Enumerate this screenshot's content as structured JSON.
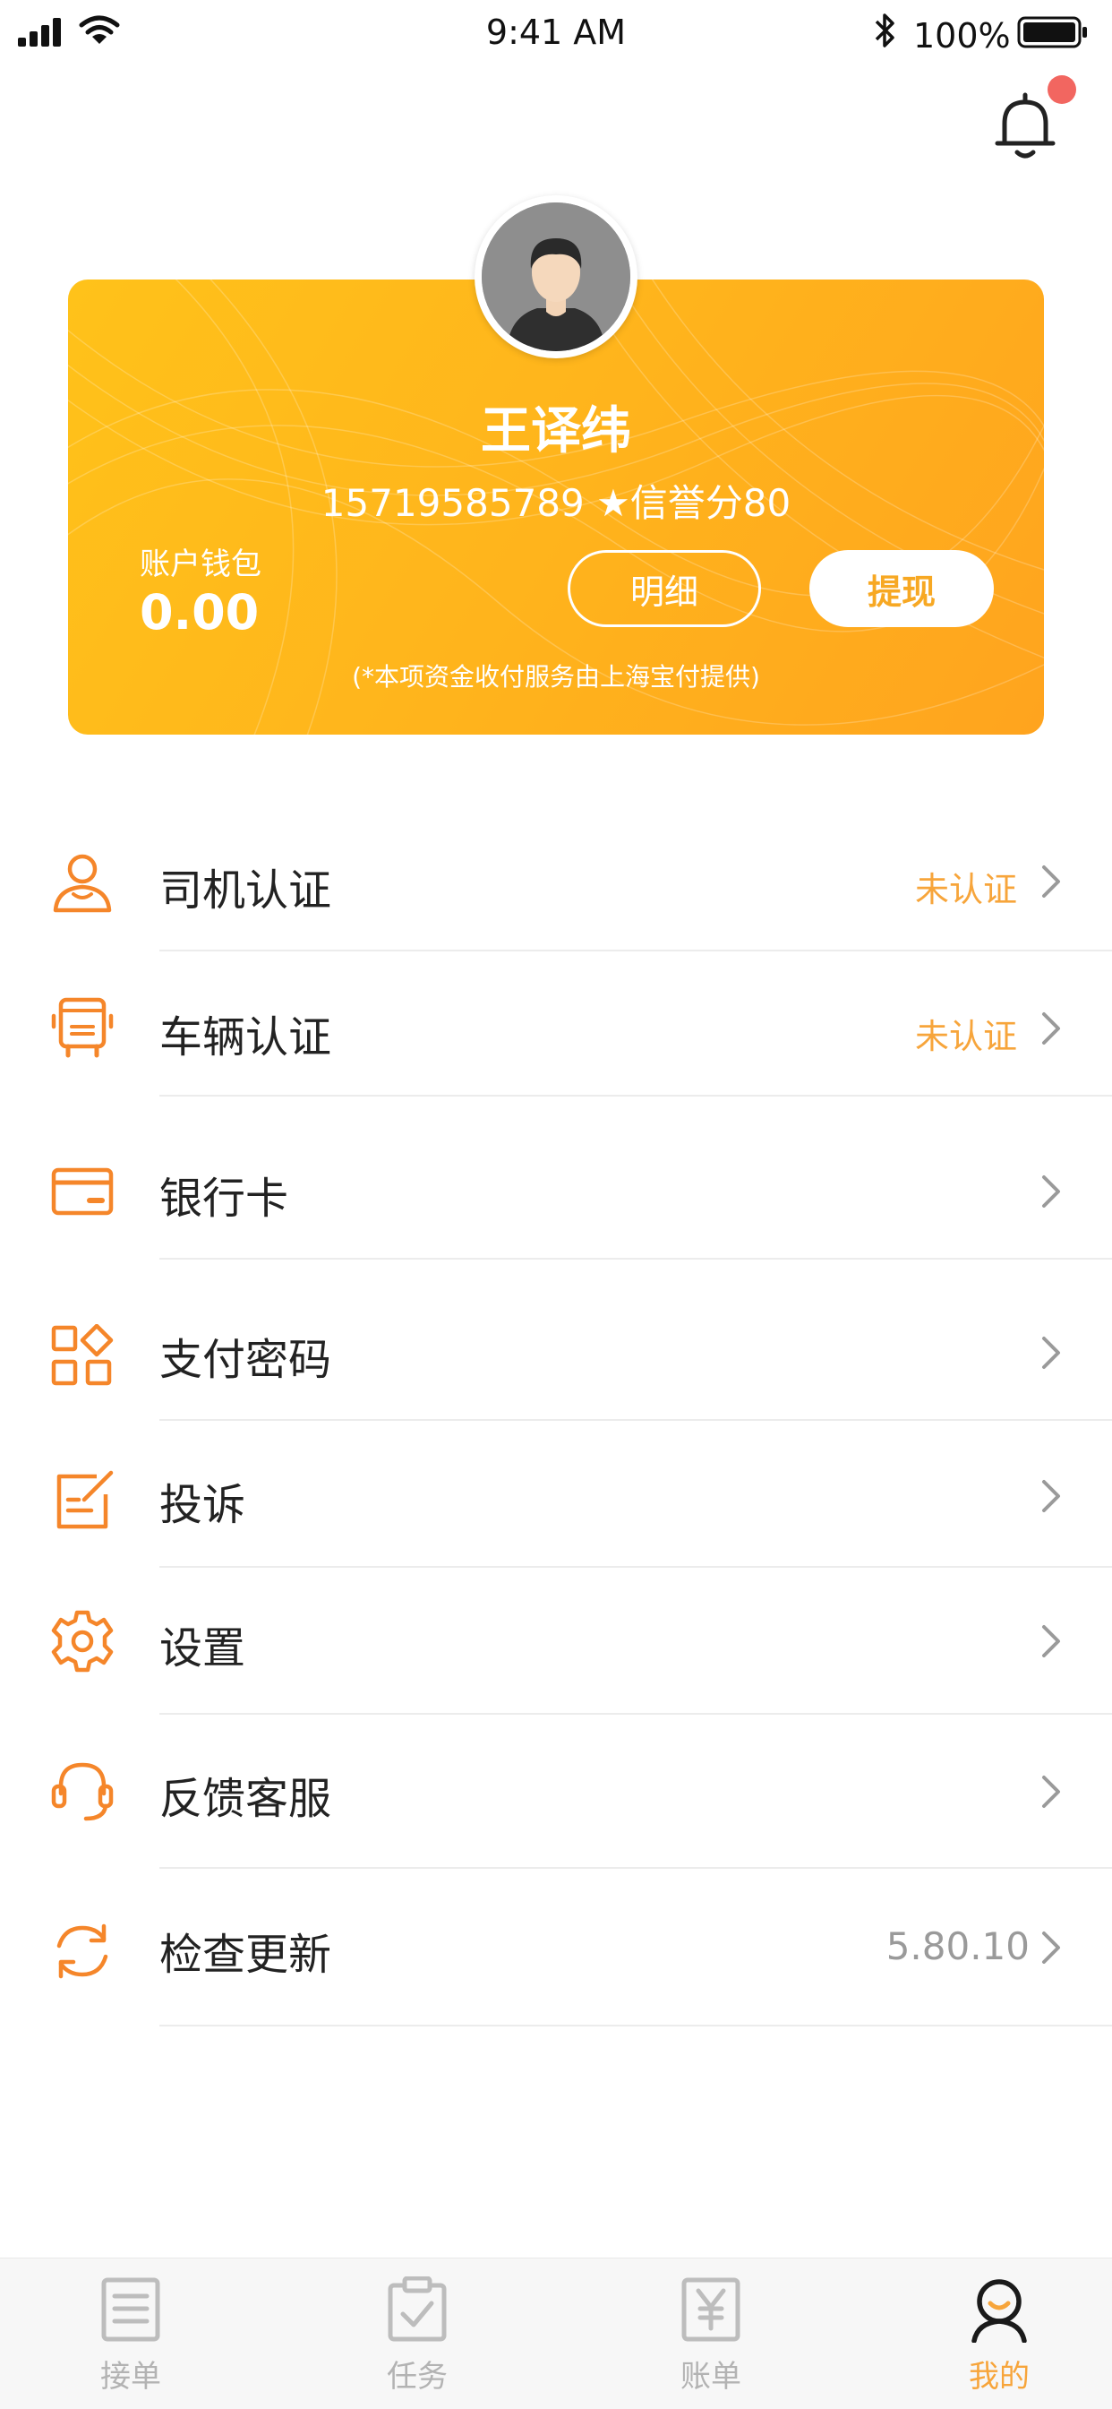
{
  "status_bar": {
    "time": "9:41 AM",
    "battery_percent": "100%"
  },
  "icons": {
    "bell": "bell-icon",
    "signal": "cellular-signal-icon",
    "wifi": "wifi-icon",
    "bluetooth": "bluetooth-icon",
    "battery": "battery-icon"
  },
  "profile": {
    "name": "王译纬",
    "info": "15719585789 ★信誉分80",
    "wallet_label": "账户钱包",
    "wallet_amount": "0.00",
    "detail_button": "明细",
    "withdraw_button": "提现",
    "note": "(*本项资金收付服务由上海宝付提供)"
  },
  "menu": [
    {
      "label": "司机认证",
      "status": "未认证",
      "icon": "driver-icon"
    },
    {
      "label": "车辆认证",
      "status": "未认证",
      "icon": "truck-icon"
    },
    {
      "label": "银行卡",
      "status": "",
      "icon": "bank-card-icon"
    },
    {
      "label": "支付密码",
      "status": "",
      "icon": "grid-apps-icon"
    },
    {
      "label": "投诉",
      "status": "",
      "icon": "edit-note-icon"
    },
    {
      "label": "设置",
      "status": "",
      "icon": "gear-icon"
    },
    {
      "label": "反馈客服",
      "status": "",
      "icon": "headset-icon"
    },
    {
      "label": "检查更新",
      "version": "5.80.10",
      "icon": "refresh-icon"
    }
  ],
  "tabs": [
    {
      "label": "接单",
      "icon": "document-icon",
      "active": false
    },
    {
      "label": "任务",
      "icon": "clipboard-check-icon",
      "active": false
    },
    {
      "label": "账单",
      "icon": "yen-bill-icon",
      "active": false
    },
    {
      "label": "我的",
      "icon": "user-icon",
      "active": true
    }
  ],
  "colors": {
    "accent": "#f7a53b",
    "card_gradient_start": "#ffc21a",
    "card_gradient_end": "#ffa41e",
    "notification_dot": "#f26660",
    "tab_inactive": "#b3b3b3"
  }
}
